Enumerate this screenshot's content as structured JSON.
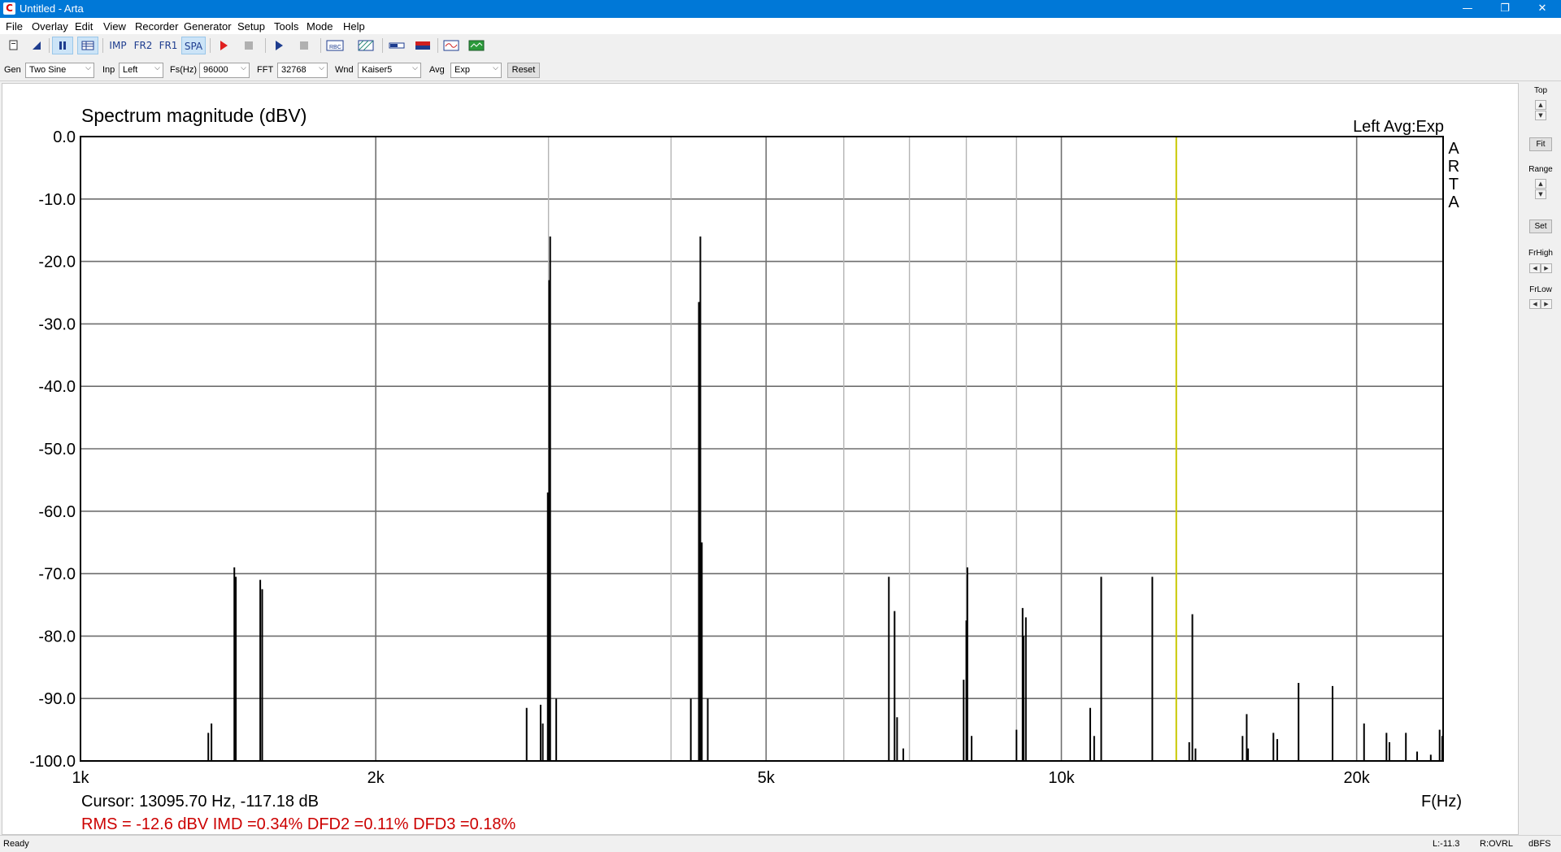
{
  "window": {
    "title": "Untitled - Arta",
    "minimize": "—",
    "restore": "❐",
    "close": "✕",
    "app_icon": "C"
  },
  "menu": [
    "File",
    "Overlay",
    "Edit",
    "View",
    "Recorder",
    "Generator",
    "Setup",
    "Tools",
    "Mode",
    "Help"
  ],
  "toolbar": {
    "text_buttons": [
      "IMP",
      "FR2",
      "FR1",
      "SPA"
    ],
    "icons": [
      "new-file-icon",
      "open-icon",
      "pause-icon",
      "grid-icon",
      "record-icon",
      "stop-icon",
      "play-icon",
      "stop2-icon",
      "abc-icon",
      "hatch-icon",
      "meter-icon",
      "flag-icon",
      "scope-icon",
      "spectrum-icon"
    ]
  },
  "params": {
    "gen_label": "Gen",
    "gen_value": "Two Sine",
    "inp_label": "Inp",
    "inp_value": "Left",
    "fs_label": "Fs(Hz)",
    "fs_value": "96000",
    "fft_label": "FFT",
    "fft_value": "32768",
    "wnd_label": "Wnd",
    "wnd_value": "Kaiser5",
    "avg_label": "Avg",
    "avg_value": "Exp",
    "reset_label": "Reset"
  },
  "side_panel": {
    "top_label": "Top",
    "fit_label": "Fit",
    "range_label": "Range",
    "set_label": "Set",
    "frhigh_label": "FrHigh",
    "frlow_label": "FrLow"
  },
  "plot": {
    "channel_info": "Left  Avg:Exp",
    "arta_letters": [
      "A",
      "R",
      "T",
      "A"
    ],
    "cursor_text": "Cursor: 13095.70 Hz, -117.18 dB",
    "measurement_text": "RMS =  -12.6 dBV  IMD =0.34%  DFD2 =0.11%  DFD3 =0.18%",
    "measurement_color": "#cc0000",
    "cursor_color": "#c8c800"
  },
  "status": {
    "left": "Ready",
    "level": "L:-11.3",
    "ovrl": "R:OVRL",
    "units": "dBFS"
  },
  "chart_data": {
    "type": "line",
    "title": "Spectrum magnitude (dBV)",
    "xlabel": "F(Hz)",
    "ylabel": "",
    "x_scale": "log",
    "xlim": [
      1000,
      24500
    ],
    "ylim": [
      -100,
      0
    ],
    "grid": true,
    "y_ticks": [
      "0.0",
      "-10.0",
      "-20.0",
      "-30.0",
      "-40.0",
      "-50.0",
      "-60.0",
      "-70.0",
      "-80.0",
      "-90.0",
      "-100.0"
    ],
    "x_ticks": [
      {
        "value": 1000,
        "label": "1k"
      },
      {
        "value": 2000,
        "label": "2k"
      },
      {
        "value": 5000,
        "label": "5k"
      },
      {
        "value": 10000,
        "label": "10k"
      },
      {
        "value": 20000,
        "label": "20k"
      }
    ],
    "x_minor_grid": [
      3000,
      4000,
      6000,
      7000,
      8000,
      9000
    ],
    "cursor_x": 13095.7,
    "series": [
      {
        "peaks": [
          {
            "f": 1350,
            "db": -95.5
          },
          {
            "f": 1360,
            "db": -94
          },
          {
            "f": 1435,
            "db": -69
          },
          {
            "f": 1440,
            "db": -70.5
          },
          {
            "f": 1525,
            "db": -71
          },
          {
            "f": 1532,
            "db": -72.5
          },
          {
            "f": 2850,
            "db": -91.5
          },
          {
            "f": 2945,
            "db": -91
          },
          {
            "f": 2960,
            "db": -94
          },
          {
            "f": 2995,
            "db": -57
          },
          {
            "f": 3005,
            "db": -23
          },
          {
            "f": 3012,
            "db": -16
          },
          {
            "f": 3055,
            "db": -90
          },
          {
            "f": 4190,
            "db": -90
          },
          {
            "f": 4270,
            "db": -26.5
          },
          {
            "f": 4285,
            "db": -16
          },
          {
            "f": 4300,
            "db": -65
          },
          {
            "f": 4360,
            "db": -90
          },
          {
            "f": 6670,
            "db": -70.5
          },
          {
            "f": 6760,
            "db": -76
          },
          {
            "f": 6800,
            "db": -93
          },
          {
            "f": 6900,
            "db": -98
          },
          {
            "f": 7950,
            "db": -87
          },
          {
            "f": 8020,
            "db": -69
          },
          {
            "f": 8000,
            "db": -77.5
          },
          {
            "f": 8100,
            "db": -96
          },
          {
            "f": 9000,
            "db": -95
          },
          {
            "f": 9130,
            "db": -75.5
          },
          {
            "f": 9200,
            "db": -77
          },
          {
            "f": 9150,
            "db": -80
          },
          {
            "f": 10700,
            "db": -91.5
          },
          {
            "f": 10800,
            "db": -96
          },
          {
            "f": 10980,
            "db": -70.5
          },
          {
            "f": 12380,
            "db": -70.5
          },
          {
            "f": 13500,
            "db": -97
          },
          {
            "f": 13600,
            "db": -76.5
          },
          {
            "f": 13700,
            "db": -98
          },
          {
            "f": 15300,
            "db": -96
          },
          {
            "f": 15450,
            "db": -92.5
          },
          {
            "f": 15500,
            "db": -98
          },
          {
            "f": 16450,
            "db": -95.5
          },
          {
            "f": 16600,
            "db": -96.5
          },
          {
            "f": 17450,
            "db": -87.5
          },
          {
            "f": 18900,
            "db": -88
          },
          {
            "f": 20350,
            "db": -94
          },
          {
            "f": 21450,
            "db": -95.5
          },
          {
            "f": 21600,
            "db": -97
          },
          {
            "f": 22450,
            "db": -95.5
          },
          {
            "f": 23050,
            "db": -98.5
          },
          {
            "f": 23800,
            "db": -99
          },
          {
            "f": 24300,
            "db": -95
          },
          {
            "f": 24450,
            "db": -96
          }
        ]
      }
    ]
  }
}
